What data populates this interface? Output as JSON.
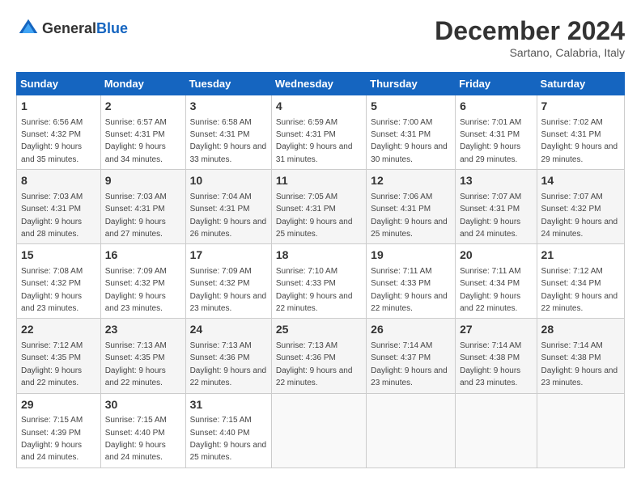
{
  "header": {
    "logo_general": "General",
    "logo_blue": "Blue",
    "month": "December 2024",
    "location": "Sartano, Calabria, Italy"
  },
  "weekdays": [
    "Sunday",
    "Monday",
    "Tuesday",
    "Wednesday",
    "Thursday",
    "Friday",
    "Saturday"
  ],
  "weeks": [
    [
      {
        "day": 1,
        "sunrise": "6:56 AM",
        "sunset": "4:32 PM",
        "daylight": "9 hours and 35 minutes."
      },
      {
        "day": 2,
        "sunrise": "6:57 AM",
        "sunset": "4:31 PM",
        "daylight": "9 hours and 34 minutes."
      },
      {
        "day": 3,
        "sunrise": "6:58 AM",
        "sunset": "4:31 PM",
        "daylight": "9 hours and 33 minutes."
      },
      {
        "day": 4,
        "sunrise": "6:59 AM",
        "sunset": "4:31 PM",
        "daylight": "9 hours and 31 minutes."
      },
      {
        "day": 5,
        "sunrise": "7:00 AM",
        "sunset": "4:31 PM",
        "daylight": "9 hours and 30 minutes."
      },
      {
        "day": 6,
        "sunrise": "7:01 AM",
        "sunset": "4:31 PM",
        "daylight": "9 hours and 29 minutes."
      },
      {
        "day": 7,
        "sunrise": "7:02 AM",
        "sunset": "4:31 PM",
        "daylight": "9 hours and 29 minutes."
      }
    ],
    [
      {
        "day": 8,
        "sunrise": "7:03 AM",
        "sunset": "4:31 PM",
        "daylight": "9 hours and 28 minutes."
      },
      {
        "day": 9,
        "sunrise": "7:03 AM",
        "sunset": "4:31 PM",
        "daylight": "9 hours and 27 minutes."
      },
      {
        "day": 10,
        "sunrise": "7:04 AM",
        "sunset": "4:31 PM",
        "daylight": "9 hours and 26 minutes."
      },
      {
        "day": 11,
        "sunrise": "7:05 AM",
        "sunset": "4:31 PM",
        "daylight": "9 hours and 25 minutes."
      },
      {
        "day": 12,
        "sunrise": "7:06 AM",
        "sunset": "4:31 PM",
        "daylight": "9 hours and 25 minutes."
      },
      {
        "day": 13,
        "sunrise": "7:07 AM",
        "sunset": "4:31 PM",
        "daylight": "9 hours and 24 minutes."
      },
      {
        "day": 14,
        "sunrise": "7:07 AM",
        "sunset": "4:32 PM",
        "daylight": "9 hours and 24 minutes."
      }
    ],
    [
      {
        "day": 15,
        "sunrise": "7:08 AM",
        "sunset": "4:32 PM",
        "daylight": "9 hours and 23 minutes."
      },
      {
        "day": 16,
        "sunrise": "7:09 AM",
        "sunset": "4:32 PM",
        "daylight": "9 hours and 23 minutes."
      },
      {
        "day": 17,
        "sunrise": "7:09 AM",
        "sunset": "4:32 PM",
        "daylight": "9 hours and 23 minutes."
      },
      {
        "day": 18,
        "sunrise": "7:10 AM",
        "sunset": "4:33 PM",
        "daylight": "9 hours and 22 minutes."
      },
      {
        "day": 19,
        "sunrise": "7:11 AM",
        "sunset": "4:33 PM",
        "daylight": "9 hours and 22 minutes."
      },
      {
        "day": 20,
        "sunrise": "7:11 AM",
        "sunset": "4:34 PM",
        "daylight": "9 hours and 22 minutes."
      },
      {
        "day": 21,
        "sunrise": "7:12 AM",
        "sunset": "4:34 PM",
        "daylight": "9 hours and 22 minutes."
      }
    ],
    [
      {
        "day": 22,
        "sunrise": "7:12 AM",
        "sunset": "4:35 PM",
        "daylight": "9 hours and 22 minutes."
      },
      {
        "day": 23,
        "sunrise": "7:13 AM",
        "sunset": "4:35 PM",
        "daylight": "9 hours and 22 minutes."
      },
      {
        "day": 24,
        "sunrise": "7:13 AM",
        "sunset": "4:36 PM",
        "daylight": "9 hours and 22 minutes."
      },
      {
        "day": 25,
        "sunrise": "7:13 AM",
        "sunset": "4:36 PM",
        "daylight": "9 hours and 22 minutes."
      },
      {
        "day": 26,
        "sunrise": "7:14 AM",
        "sunset": "4:37 PM",
        "daylight": "9 hours and 23 minutes."
      },
      {
        "day": 27,
        "sunrise": "7:14 AM",
        "sunset": "4:38 PM",
        "daylight": "9 hours and 23 minutes."
      },
      {
        "day": 28,
        "sunrise": "7:14 AM",
        "sunset": "4:38 PM",
        "daylight": "9 hours and 23 minutes."
      }
    ],
    [
      {
        "day": 29,
        "sunrise": "7:15 AM",
        "sunset": "4:39 PM",
        "daylight": "9 hours and 24 minutes."
      },
      {
        "day": 30,
        "sunrise": "7:15 AM",
        "sunset": "4:40 PM",
        "daylight": "9 hours and 24 minutes."
      },
      {
        "day": 31,
        "sunrise": "7:15 AM",
        "sunset": "4:40 PM",
        "daylight": "9 hours and 25 minutes."
      },
      null,
      null,
      null,
      null
    ]
  ]
}
